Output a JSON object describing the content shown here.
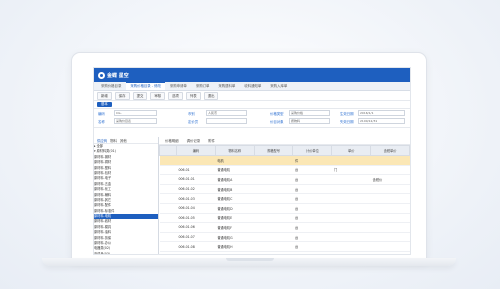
{
  "app": {
    "logo_text": "金蝶 星空"
  },
  "tabs": [
    {
      "label": "采购价格目录"
    },
    {
      "label": "采购价格目录 - 修改",
      "active": true
    },
    {
      "label": "采购申请单"
    },
    {
      "label": "采购订单"
    },
    {
      "label": "采购退料单"
    },
    {
      "label": "收料通知单"
    },
    {
      "label": "采购入库单"
    }
  ],
  "toolbar": [
    "新增",
    "保存",
    "提交",
    "审核",
    "选项",
    "列表",
    "退出"
  ],
  "subtab": "基本",
  "form": {
    "fields": [
      {
        "label": "编码",
        "value": "CG.."
      },
      {
        "label": "名称",
        "value": "采购价目表"
      },
      {
        "label": "币别",
        "value": "人民币"
      },
      {
        "label": "定价员",
        "value": ""
      },
      {
        "label": "价格类型",
        "value": "采购价格"
      },
      {
        "label": "价目对象",
        "value": "按物料"
      },
      {
        "label": "生效日期",
        "value": "2016/1/1"
      },
      {
        "label": "失效日期",
        "value": "2100/12/31"
      }
    ]
  },
  "tree": {
    "tabs": [
      "供应商",
      "物料",
      "其他"
    ],
    "nodes": [
      {
        "label": "▸ 全部"
      },
      {
        "label": "▾ 原材料类(01)"
      },
      {
        "label": "  原材料-钢材"
      },
      {
        "label": "  原材料-铜材"
      },
      {
        "label": "  原材料-塑料"
      },
      {
        "label": "  原材料-包材"
      },
      {
        "label": "  原材料-电子"
      },
      {
        "label": "  原材料-五金"
      },
      {
        "label": "  原材料-化工"
      },
      {
        "label": "  原材料-辅料"
      },
      {
        "label": "  原材料-其它"
      },
      {
        "label": "  原材料-配件"
      },
      {
        "label": "  原材料-标准件"
      },
      {
        "label": "  原材料-电机",
        "selected": true
      },
      {
        "label": "  原材料-线材"
      },
      {
        "label": "  原材料-模具"
      },
      {
        "label": "  原材料-油料"
      },
      {
        "label": "  原材料-劳保"
      },
      {
        "label": "  原材料-办公"
      },
      {
        "label": "  电器类(02)"
      },
      {
        "label": "  产成品(03)"
      }
    ]
  },
  "grid": {
    "tabs": [
      "价格明细",
      "调价记录",
      "附件"
    ],
    "headers": [
      "编码",
      "物料名称",
      "规格型号",
      "计价单位",
      "单价",
      "含税单价"
    ],
    "rows": [
      [
        "",
        "电机",
        "",
        "件",
        "",
        ""
      ],
      [
        "006.01",
        "普通电机",
        "",
        "台",
        "门",
        ""
      ],
      [
        "006.01.01",
        "普通电机A",
        "",
        "台",
        "",
        "含税价"
      ],
      [
        "006.01.02",
        "普通电机B",
        "",
        "台",
        "",
        ""
      ],
      [
        "006.01.03",
        "普通电机C",
        "",
        "台",
        "",
        ""
      ],
      [
        "006.01.04",
        "普通电机D",
        "",
        "台",
        "",
        ""
      ],
      [
        "006.01.05",
        "普通电机E",
        "",
        "台",
        "",
        ""
      ],
      [
        "006.01.06",
        "普通电机F",
        "",
        "台",
        "",
        ""
      ],
      [
        "006.01.07",
        "普通电机G",
        "",
        "台",
        "",
        ""
      ],
      [
        "006.01.08",
        "普通电机H",
        "",
        "台",
        "",
        ""
      ],
      [
        "006.01.09",
        "普通电机I",
        "",
        "台",
        "",
        ""
      ],
      [
        "006.01.10",
        "普通电机J",
        "",
        "台",
        "",
        ""
      ]
    ],
    "highlight_row": 0
  },
  "colors": {
    "accent": "#1e5fbf",
    "highlight": "#fbe7b5"
  }
}
